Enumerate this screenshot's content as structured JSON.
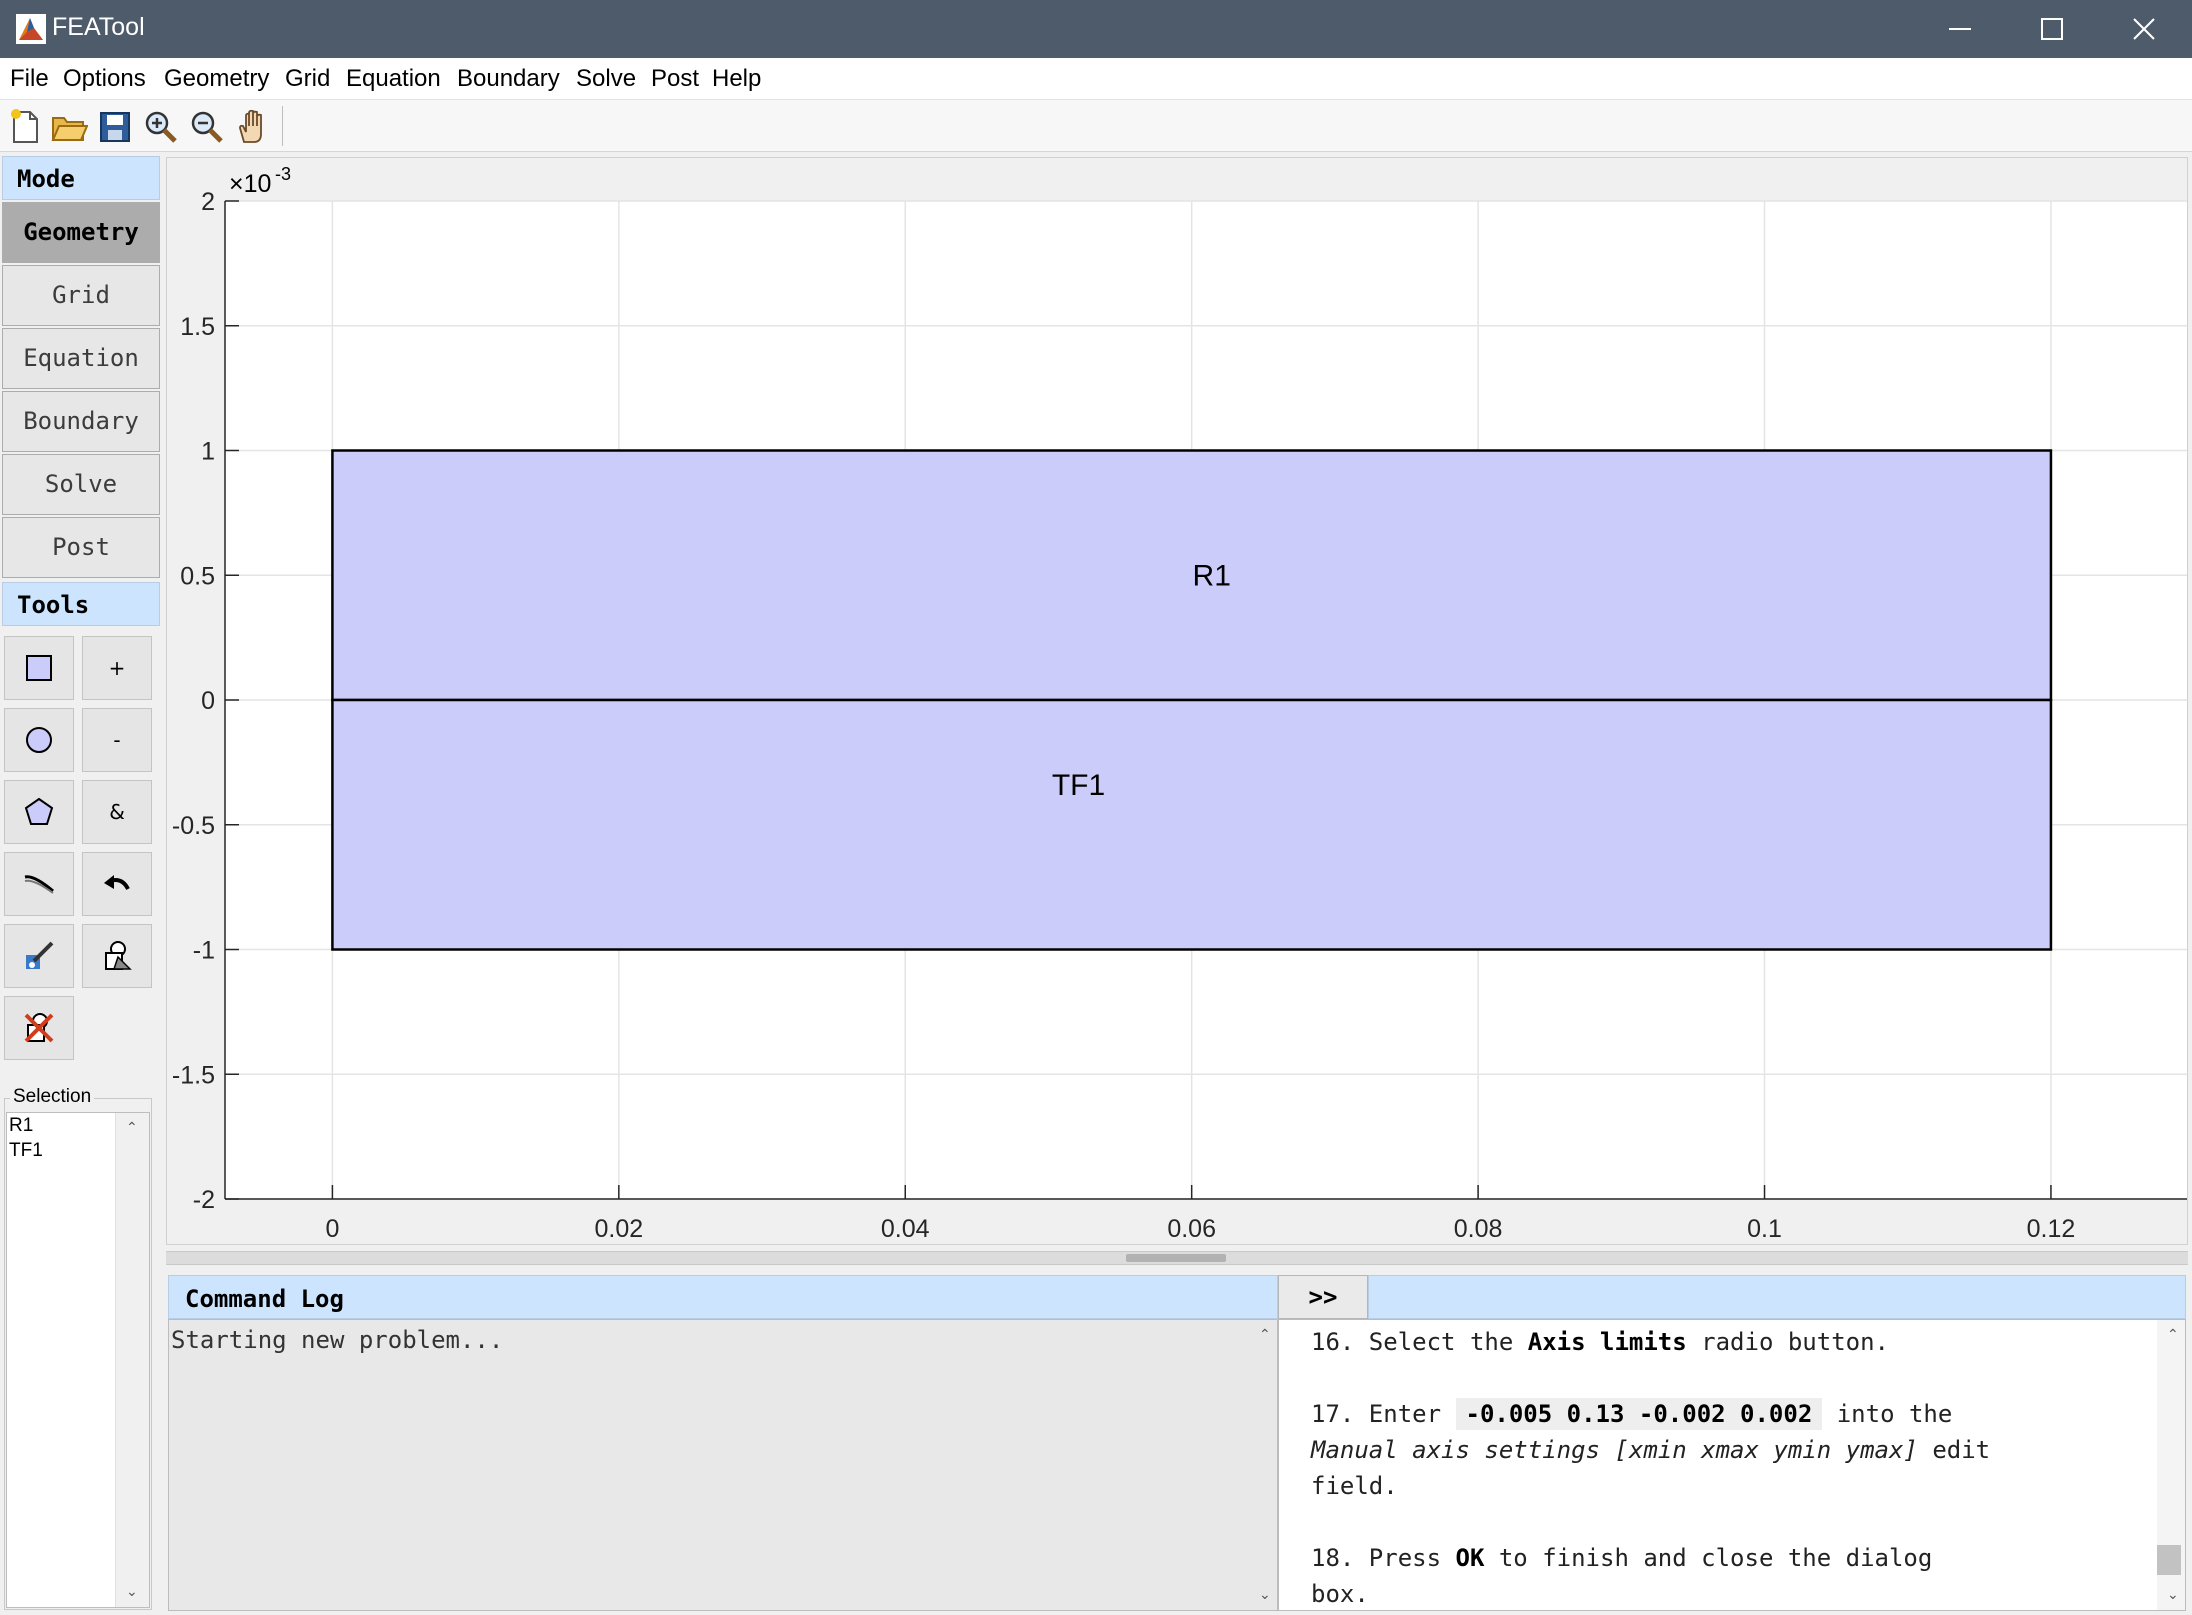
{
  "window": {
    "title": "FEATool"
  },
  "menu": [
    "File",
    "Options",
    "Geometry",
    "Grid",
    "Equation",
    "Boundary",
    "Solve",
    "Post",
    "Help"
  ],
  "toolbar": {
    "icons": [
      "new-file-icon",
      "open-folder-icon",
      "save-icon",
      "zoom-in-icon",
      "zoom-out-icon",
      "pan-hand-icon"
    ]
  },
  "left_panel": {
    "mode_header": "Mode",
    "modes": [
      {
        "label": "Geometry",
        "active": true
      },
      {
        "label": "Grid",
        "active": false
      },
      {
        "label": "Equation",
        "active": false
      },
      {
        "label": "Boundary",
        "active": false
      },
      {
        "label": "Solve",
        "active": false
      },
      {
        "label": "Post",
        "active": false
      }
    ],
    "tools_header": "Tools",
    "tools": {
      "union": "+",
      "difference": "-",
      "intersection": "&"
    },
    "selection_label": "Selection",
    "selection_items": [
      "R1",
      "TF1"
    ]
  },
  "chart_data": {
    "type": "geometry",
    "y_exponent_label": "×10",
    "y_exponent_power": "-3",
    "xlim": [
      -0.0075,
      0.1295
    ],
    "ylim": [
      -0.002,
      0.002
    ],
    "x_ticks": [
      {
        "value": 0,
        "label": "0"
      },
      {
        "value": 0.02,
        "label": "0.02"
      },
      {
        "value": 0.04,
        "label": "0.04"
      },
      {
        "value": 0.06,
        "label": "0.06"
      },
      {
        "value": 0.08,
        "label": "0.08"
      },
      {
        "value": 0.1,
        "label": "0.1"
      },
      {
        "value": 0.12,
        "label": "0.12"
      }
    ],
    "y_ticks": [
      {
        "value": 0.002,
        "label": "2"
      },
      {
        "value": 0.0015,
        "label": "1.5"
      },
      {
        "value": 0.001,
        "label": "1"
      },
      {
        "value": 0.0005,
        "label": "0.5"
      },
      {
        "value": 0,
        "label": "0"
      },
      {
        "value": -0.0005,
        "label": "-0.5"
      },
      {
        "value": -0.001,
        "label": "-1"
      },
      {
        "value": -0.0015,
        "label": "-1.5"
      },
      {
        "value": -0.002,
        "label": "-2"
      }
    ],
    "grid": true,
    "objects": [
      {
        "name": "R1",
        "xmin": 0,
        "xmax": 0.12,
        "ymin": 0,
        "ymax": 0.001,
        "label_x": 0.0614,
        "label_y": 0.0005
      },
      {
        "name": "TF1",
        "xmin": 0,
        "xmax": 0.12,
        "ymin": -0.001,
        "ymax": 0,
        "label_x": 0.0521,
        "label_y": -0.00034
      }
    ],
    "fill_color": "#ccccfa",
    "edge_color": "#000000"
  },
  "command_log": {
    "header": "Command Log",
    "expand_label": ">>",
    "text": "Starting new problem..."
  },
  "help": {
    "line16_prefix": "16. Select the ",
    "line16_bold": "Axis limits",
    "line16_suffix": " radio button.",
    "line17_prefix": "17. Enter ",
    "line17_code": "-0.005 0.13 -0.002 0.002",
    "line17_suffix": " into the",
    "line17b_italic": "Manual axis settings [xmin xmax ymin ymax]",
    "line17b_suffix": " edit",
    "line17c": "field.",
    "line18_prefix": "18. Press ",
    "line18_bold": "OK",
    "line18_suffix": " to finish and close the dialog",
    "line18b": "box."
  },
  "colors": {
    "titlebar": "#4e5b6b",
    "header_blue": "#cde4ff",
    "active_mode": "#acacac"
  }
}
